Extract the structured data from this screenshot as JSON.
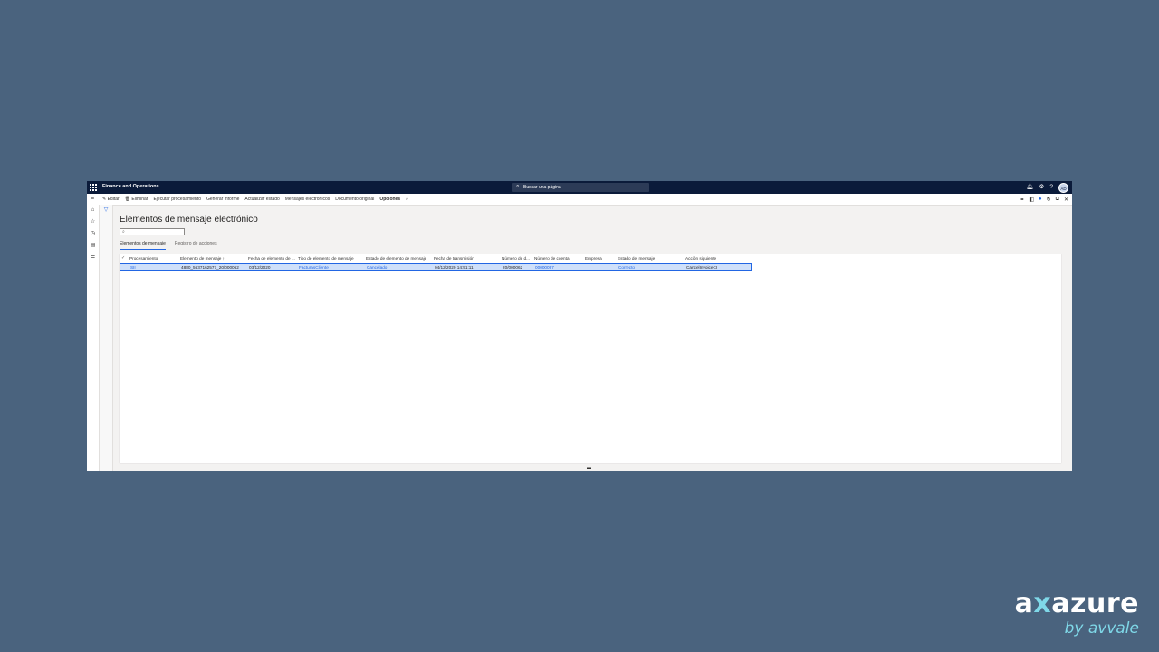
{
  "topbar": {
    "app_title": "Finance and Operations",
    "search_placeholder": "Buscar una página",
    "avatar_initials": "AD"
  },
  "actions": {
    "edit": "Editar",
    "delete": "Eliminar",
    "run": "Ejecutar procesamiento",
    "report": "Generar informe",
    "update_status": "Actualizar estado",
    "messages": "Mensajes electrónicos",
    "original_doc": "Documento original",
    "options": "Opciones"
  },
  "page": {
    "title": "Elementos de mensaje electrónico"
  },
  "tabs": [
    {
      "label": "Elementos de mensaje",
      "active": true
    },
    {
      "label": "Registro de acciones",
      "active": false
    }
  ],
  "grid": {
    "columns": [
      "Procesamiento",
      "Elemento de mensaje ↑",
      "Fecha de elemento de ...",
      "Tipo de elemento de mensaje",
      "Estado de elemento de mensaje",
      "Fecha de transmisión",
      "Número de d...",
      "Número de cuenta",
      "Empresa",
      "Estado del mensaje",
      "Acción siguiente"
    ],
    "rows": [
      {
        "processing": "SII",
        "message_item": "4880_5637162577_20/000062",
        "item_date": "03/12/2020",
        "item_type": "FacturasCliente",
        "item_status": "Cancelado",
        "transmission_date": "04/12/2020 14:51:11",
        "doc_number": "20/000062",
        "account_number": "00000097",
        "company": "",
        "message_status": "Correcto",
        "next_action": "CancelInvoiceCI"
      }
    ]
  },
  "logo": {
    "brand_a": "a",
    "brand_x": "x",
    "brand_rest": "azure",
    "sub": "by avvale"
  },
  "colors": {
    "background": "#4a637e",
    "topbar": "#0b1b3a",
    "accent": "#2266e3",
    "selected_row": "#cfe0fa",
    "logo_accent": "#7fd8e8"
  }
}
